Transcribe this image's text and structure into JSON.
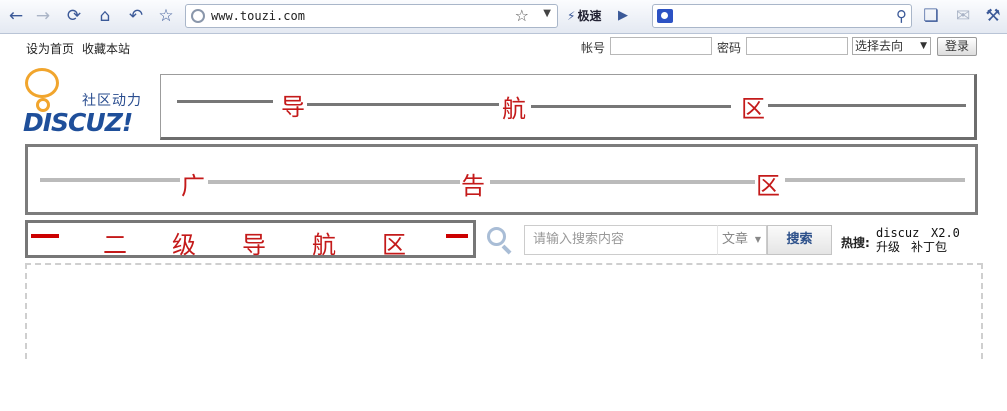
{
  "browser": {
    "url": "www.touzi.com",
    "speed_label": "极速",
    "nav_icons": [
      "back-icon",
      "forward-icon",
      "refresh-icon",
      "home-icon",
      "undo-icon",
      "star-icon"
    ],
    "extra_icons": [
      "search-icon",
      "favorites-icon",
      "mail-icon",
      "tools-icon"
    ]
  },
  "topbar": {
    "set_home": "设为首页",
    "bookmark": "收藏本站",
    "account_label": "帐号",
    "password_label": "密码",
    "goto_select": "选择去向",
    "login_button": "登录"
  },
  "logo": {
    "tagline": "社区动力",
    "wordmark": "DISCUZ!"
  },
  "zones": {
    "nav": [
      "导",
      "航",
      "区"
    ],
    "ad": [
      "广",
      "告",
      "区"
    ],
    "subnav": [
      "二",
      "级",
      "导",
      "航",
      "区"
    ]
  },
  "search": {
    "placeholder": "请输入搜索内容",
    "type": "文章",
    "button": "搜索",
    "hot_label": "热搜:",
    "hot_keywords": [
      "discuz",
      "X2.0",
      "升级",
      "补丁包"
    ]
  },
  "colors": {
    "zone_text": "#c41a1a",
    "link": "#2b4f8a"
  }
}
